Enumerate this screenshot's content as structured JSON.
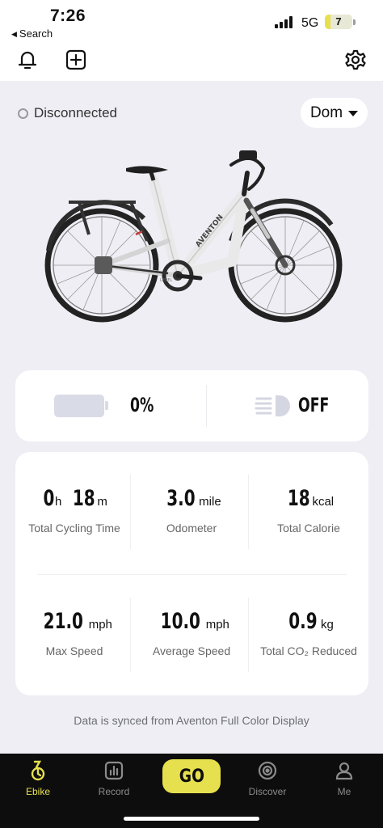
{
  "status_bar": {
    "time": "7:26",
    "back_label": "Search",
    "network": "5G",
    "battery_level": "7",
    "battery_accent": "#e7e04a"
  },
  "header": {
    "icons": [
      "bell-icon",
      "add-icon",
      "gear-icon"
    ]
  },
  "connection": {
    "status": "Disconnected",
    "profile_name": "Dom"
  },
  "battery_light": {
    "battery_percent": "0%",
    "light_state": "OFF"
  },
  "stats": [
    {
      "parts": [
        {
          "num": "0",
          "unit": "h"
        },
        {
          "num": "18",
          "unit": "m"
        }
      ],
      "label": "Total Cycling Time"
    },
    {
      "parts": [
        {
          "num": "3.0",
          "unit": "mile"
        }
      ],
      "label": "Odometer"
    },
    {
      "parts": [
        {
          "num": "18",
          "unit": "kcal"
        }
      ],
      "label": "Total Calorie"
    },
    {
      "parts": [
        {
          "num": "21.0",
          "unit": "mph"
        }
      ],
      "label": "Max Speed"
    },
    {
      "parts": [
        {
          "num": "10.0",
          "unit": "mph"
        }
      ],
      "label": "Average Speed"
    },
    {
      "parts": [
        {
          "num": "0.9",
          "unit": "kg"
        }
      ],
      "label": "Total CO₂ Reduced"
    }
  ],
  "sync_note": "Data is synced from Aventon Full Color Display",
  "tabbar": {
    "accent": "#e6e04e",
    "tabs": [
      {
        "label": "Ebike",
        "icon": "ebike-icon",
        "active": true
      },
      {
        "label": "Record",
        "icon": "record-icon",
        "active": false
      },
      {
        "label": "GO",
        "icon": "go-button",
        "active": false
      },
      {
        "label": "Discover",
        "icon": "discover-icon",
        "active": false
      },
      {
        "label": "Me",
        "icon": "profile-icon",
        "active": false
      }
    ]
  },
  "bike_image": {
    "brand_text": "AVENTON",
    "model_text": "LEVEL"
  }
}
